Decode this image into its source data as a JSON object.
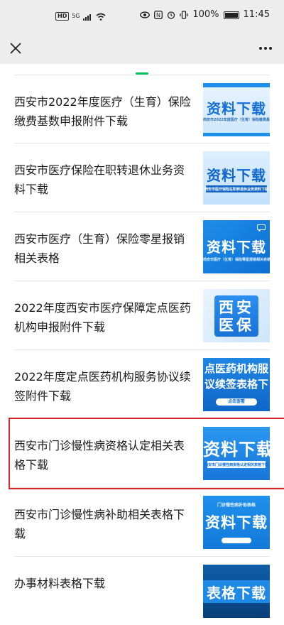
{
  "status_bar": {
    "network": "HD",
    "signal": "5G",
    "battery": "100%",
    "time": "11:45"
  },
  "nav": {
    "close_icon": "close-icon",
    "more_icon": "more-icon"
  },
  "items": [
    {
      "title": "西安市2022年度医疗（生育）保险缴费基数申报附件下载",
      "thumb_text": "资料下载",
      "thumb_sub": "西安市2022年度医疗（生育）保险缴费基数申报附件下载"
    },
    {
      "title": "西安市医疗保险在职转退休业务资料下载",
      "thumb_text": "资料下载",
      "thumb_sub": "西安市医疗保险在职转退休业务资料下载"
    },
    {
      "title": "西安市医疗（生育）保险零星报销相关表格",
      "thumb_text": "资料下载",
      "thumb_sub": "西安市医疗（生育）保险零星报销相关表格"
    },
    {
      "title": "2022年度西安市医疗保障定点医药机构申报附件下载",
      "thumb_text": "西安医保",
      "thumb_sub": ""
    },
    {
      "title": "2022年度定点医药机构服务协议续签附件下载",
      "thumb_text": "点医药机构服议续签表格下",
      "thumb_sub": "点击查看"
    },
    {
      "title": "西安市门诊慢性病资格认定相关表格下载",
      "thumb_text": "资料下载",
      "thumb_sub": "西安市门诊慢性病资格认定相关表格下载"
    },
    {
      "title": "西安市门诊慢性病补助相关表格下载",
      "thumb_text": "资料下载",
      "thumb_sub": "门诊慢性病补助表格"
    },
    {
      "title": "办事材料表格下载",
      "thumb_text": "表格下载",
      "thumb_sub": ""
    }
  ],
  "colors": {
    "accent_green": "#07c160",
    "highlight_red": "#d9232e",
    "thumb_blue": "#1f8ee8"
  }
}
